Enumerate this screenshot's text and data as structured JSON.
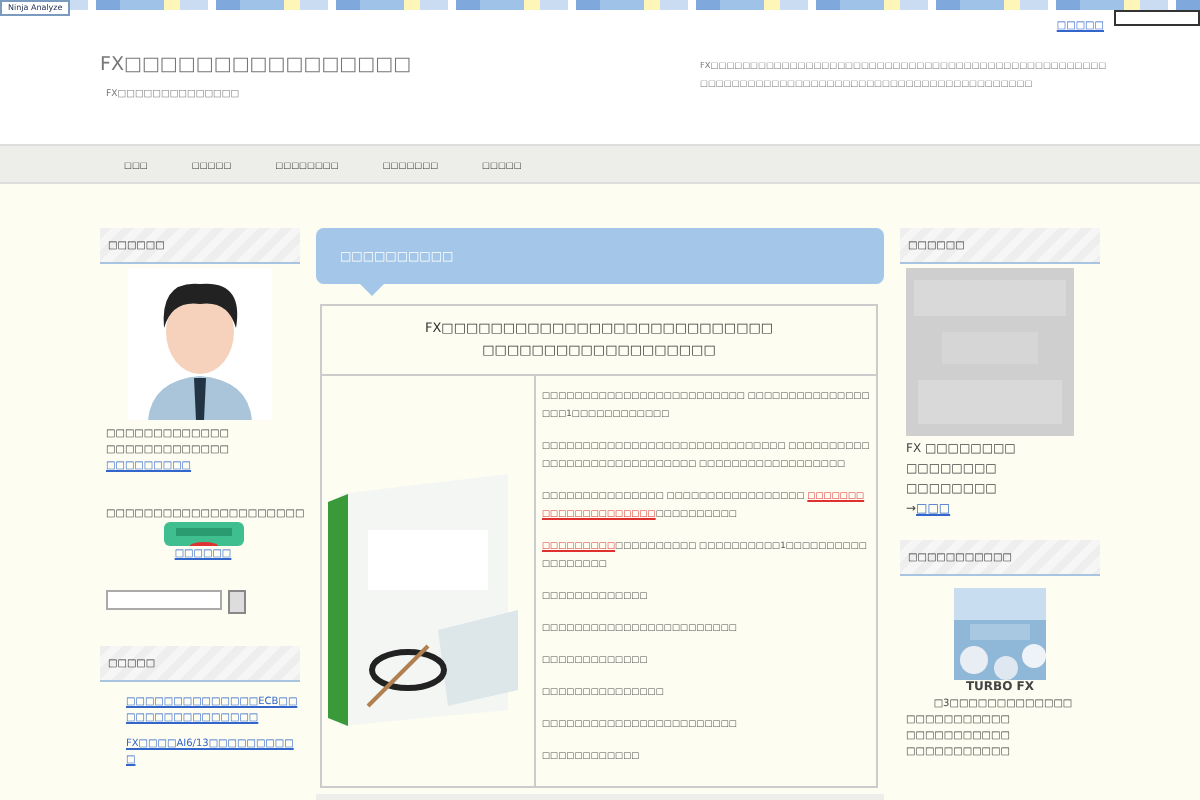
{
  "toolbar_badge": "Ninja Analyze",
  "top_link": "□□□□□",
  "header": {
    "title": "FX□□□□□□□□□□□□□□□□",
    "subtitle": "FX□□□□□□□□□□□□□□",
    "description": "FX□□□□□□□□□□□□□□□□□□□□□□□□□□□□□□□□□□□□□□□□□□□□□□□□□□□□□□□□□□□□□□□□□□□□□□□□□□□□□□□□□□□□□□□□□□□□"
  },
  "nav": [
    {
      "label": "□□□"
    },
    {
      "label": "□□□□□"
    },
    {
      "label": "□□□□□□□□"
    },
    {
      "label": "□□□□□□□"
    },
    {
      "label": "□□□□□"
    }
  ],
  "left": {
    "profile_heading": "□□□□□□",
    "profile_lines": [
      "□□□□□□□□□□□□□",
      "□□□□□□□□□□□□□"
    ],
    "profile_link": "□□□□□□□□□",
    "promo_text": "□□□□□□□□□□□□□□□□□□□□□",
    "promo_link": "□□□□□□",
    "recent_heading": "□□□□□",
    "recent": [
      "□□□□□□□□□□□□□□ECB□□□□□□□□□□□□□□□□",
      "FX□□□□AI6/13□□□□□□□□□□"
    ]
  },
  "main": {
    "heading": "□□□□□□□□□□",
    "table_title": [
      "FX□□□□□□□□□□□□□□□□□□□□□□□□□□□",
      "□□□□□□□□□□□□□□□□□□□"
    ],
    "paragraphs": [
      [
        {
          "text": "□□□□□□□□□□□□□□□□□□□□□□□□□ □□□□□□□□□□□□□□□□□□1□□□□□□□□□□□□",
          "highlight": false
        }
      ],
      [
        {
          "text": "□□□□□□□□□□□□□□□□□□□□□□□□□□□□□□ □□□□□□□□□□□□□□□□□□□□□□□□□□□□□ □□□□□□□□□□□□□□□□□□",
          "highlight": false
        }
      ],
      [
        {
          "text": "□□□□□□□□□□□□□□□ □□□□□□□□□□□□□□□□□ ",
          "highlight": false
        },
        {
          "text": "□□□□□□□□□□□□□□□□□□□□□",
          "highlight": true
        },
        {
          "text": "□□□□□□□□□□",
          "highlight": false
        }
      ],
      [
        {
          "text": "□□□□□□□□□",
          "highlight": true
        },
        {
          "text": "□□□□□□□□□□ □□□□□□□□□□1□□□□□□□□□□□□□□□□□□",
          "highlight": false
        }
      ],
      [
        {
          "text": "□□□□□□□□□□□□□",
          "highlight": false
        }
      ],
      [
        {
          "text": "□□□□□□□□□□□□□□□□□□□□□□□□",
          "highlight": false
        }
      ],
      [
        {
          "text": "□□□□□□□□□□□□□",
          "highlight": false
        }
      ],
      [
        {
          "text": "□□□□□□□□□□□□□□□",
          "highlight": false
        }
      ],
      [
        {
          "text": "□□□□□□□□□□□□□□□□□□□□□□□□",
          "highlight": false
        }
      ],
      [
        {
          "text": "□□□□□□□□□□□□",
          "highlight": false
        }
      ]
    ]
  },
  "right": {
    "mail_heading": "□□□□□□",
    "mail_lines": [
      "FX □□□□□□□□",
      "□□□□□□□□",
      "□□□□□□□□"
    ],
    "mail_arrow": "→",
    "mail_link": "□□□",
    "tool_heading": "□□□□□□□□□□□",
    "tool_name": "TURBO FX",
    "tool_lines": [
      "□3□□□□□□□□□□□□□",
      "□□□□□□□□□□□",
      "□□□□□□□□□□□",
      "□□□□□□□□□□□"
    ]
  }
}
